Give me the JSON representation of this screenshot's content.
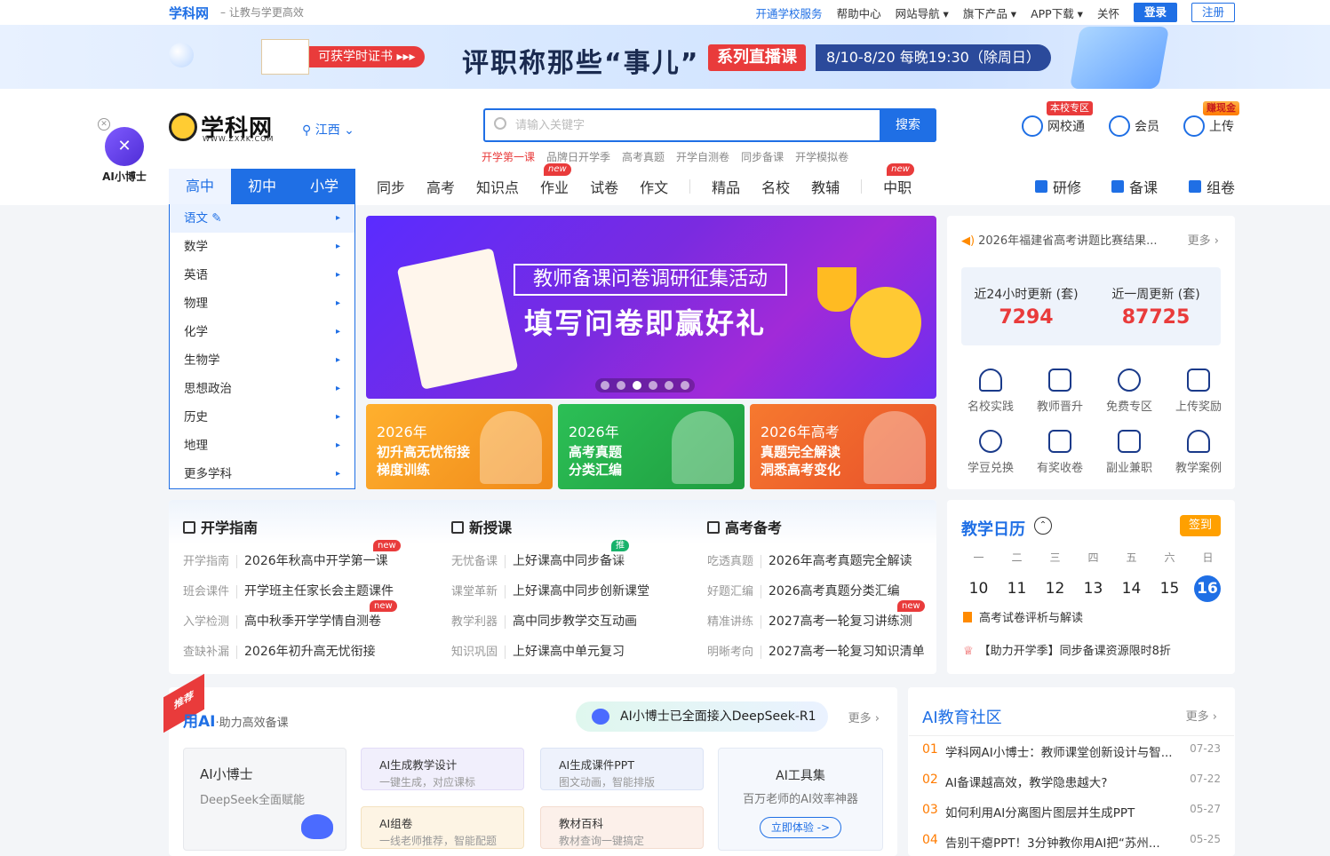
{
  "topbar": {
    "logo": "学科网",
    "slogan": "– 让教与学更高效",
    "links": [
      "开通学校服务",
      "帮助中心",
      "网站导航 ▾",
      "旗下产品 ▾",
      "APP下载 ▾",
      "关怀"
    ],
    "login": "登录",
    "register": "注册"
  },
  "banner": {
    "cert_tag": "可获学时证书 ▸▸▸",
    "title": "评职称那些“事儿”",
    "series": "系列直播课",
    "date": "8/10-8/20 每晚19:30（除周日）"
  },
  "header": {
    "ai_label": "AI小博士",
    "logo_name": "学科网",
    "logo_url": "WWW.ZXXK.COM",
    "region": "江西",
    "search_placeholder": "请输入关键字",
    "search_button": "搜索",
    "hotwords": [
      "开学第一课",
      "品牌日开学季",
      "高考真题",
      "开学自测卷",
      "同步备课",
      "开学模拟卷"
    ],
    "quick": [
      {
        "label": "网校通",
        "tag": "本校专区"
      },
      {
        "label": "会员",
        "tag": ""
      },
      {
        "label": "上传",
        "tag": "赚现金"
      }
    ]
  },
  "nav": {
    "stages": [
      "高中",
      "初中",
      "小学"
    ],
    "items": [
      "同步",
      "高考",
      "知识点",
      "作业",
      "试卷",
      "作文",
      "精品",
      "名校",
      "教辅",
      "中职"
    ],
    "new_tag": "new",
    "right": [
      "研修",
      "备课",
      "组卷"
    ]
  },
  "subjects": [
    "语文",
    "数学",
    "英语",
    "物理",
    "化学",
    "生物学",
    "思想政治",
    "历史",
    "地理",
    "更多学科"
  ],
  "hero": {
    "frame": "教师备课问卷调研征集活动",
    "big": "填写问卷即赢好礼",
    "slides": 6,
    "active_slide": 3
  },
  "promos": [
    {
      "l1": "2026年",
      "l2a": "初升高无忧衔接",
      "l2b": "梯度训练",
      "color": "#f5a623"
    },
    {
      "l1": "2026年",
      "l2a": "高考真题",
      "l2b": "分类汇编",
      "color": "#2fb34a"
    },
    {
      "l1": "2026年高考",
      "l2a": "真题完全解读",
      "l2b": "洞悉高考变化",
      "color": "#f0612a"
    }
  ],
  "rpanel": {
    "notice": "2026年福建省高考讲题比赛结果...",
    "more": "更多 ›",
    "stat1_label": "近24小时更新 (套)",
    "stat1_value": "7294",
    "stat2_label": "近一周更新 (套)",
    "stat2_value": "87725",
    "grid": [
      "名校实践",
      "教师晋升",
      "免费专区",
      "上传奖励",
      "学豆兑换",
      "有奖收卷",
      "副业兼职",
      "教学案例"
    ]
  },
  "sec2": {
    "cols": [
      {
        "title": "开学指南",
        "rows": [
          {
            "k": "开学指南",
            "v": "2026年秋高中开学第一课"
          },
          {
            "k": "班会课件",
            "v": "开学班主任家长会主题课件"
          },
          {
            "k": "入学检测",
            "v": "高中秋季开学学情自测卷"
          },
          {
            "k": "查缺补漏",
            "v": "2026年初升高无忧衔接"
          }
        ]
      },
      {
        "title": "新授课",
        "rows": [
          {
            "k": "无忧备课",
            "v": "上好课高中同步备课"
          },
          {
            "k": "课堂革新",
            "v": "上好课高中同步创新课堂"
          },
          {
            "k": "教学利器",
            "v": "高中同步教学交互动画"
          },
          {
            "k": "知识巩固",
            "v": "上好课高中单元复习"
          }
        ]
      },
      {
        "title": "高考备考",
        "rows": [
          {
            "k": "吃透真题",
            "v": "2026年高考真题完全解读"
          },
          {
            "k": "好题汇编",
            "v": "2026高考真题分类汇编"
          },
          {
            "k": "精准讲练",
            "v": "2027高考一轮复习讲练测"
          },
          {
            "k": "明晰考向",
            "v": "2027高考一轮复习知识清单"
          }
        ]
      }
    ],
    "tag_new": "new",
    "tag_rec": "推荐"
  },
  "calendar": {
    "title": "教学日历",
    "sign": "签到",
    "weekdays": [
      "一",
      "二",
      "三",
      "四",
      "五",
      "六",
      "日"
    ],
    "dates": [
      "10",
      "11",
      "12",
      "13",
      "14",
      "15",
      "16"
    ],
    "ev1": "高考试卷评析与解读",
    "ev2": "【助力开学季】同步备课资源限时8折"
  },
  "ai": {
    "ribbon": "推荐",
    "title": "用AI",
    "subtitle": "·助力高效备课",
    "deepseek": "AI小博士已全面接入DeepSeek-R1",
    "more": "更多 ›",
    "card_main_t": "AI小博士",
    "card_main_s": "DeepSeek全面赋能",
    "c1_t": "AI生成教学设计",
    "c1_s": "一键生成，对应课标",
    "c2_t": "AI生成课件PPT",
    "c2_s": "图文动画，智能排版",
    "c3_t": "AI组卷",
    "c3_s": "一线老师推荐，智能配题",
    "c4_t": "教材百科",
    "c4_s": "教材查询一键搞定",
    "tools_t": "AI工具集",
    "tools_s": "百万老师的AI效率神器",
    "tools_btn": "立即体验 ->"
  },
  "community": {
    "title": "AI教育社区",
    "more": "更多 ›",
    "items": [
      {
        "n": "01",
        "t": "学科网AI小博士：教师课堂创新设计与智...",
        "d": "07-23"
      },
      {
        "n": "02",
        "t": "AI备课越高效，教学隐患越大?",
        "d": "07-22"
      },
      {
        "n": "03",
        "t": "如何利用AI分离图片图层并生成PPT",
        "d": "05-27"
      },
      {
        "n": "04",
        "t": "告别干瘪PPT！3分钟教你用AI把“苏州...",
        "d": "05-25"
      }
    ]
  }
}
